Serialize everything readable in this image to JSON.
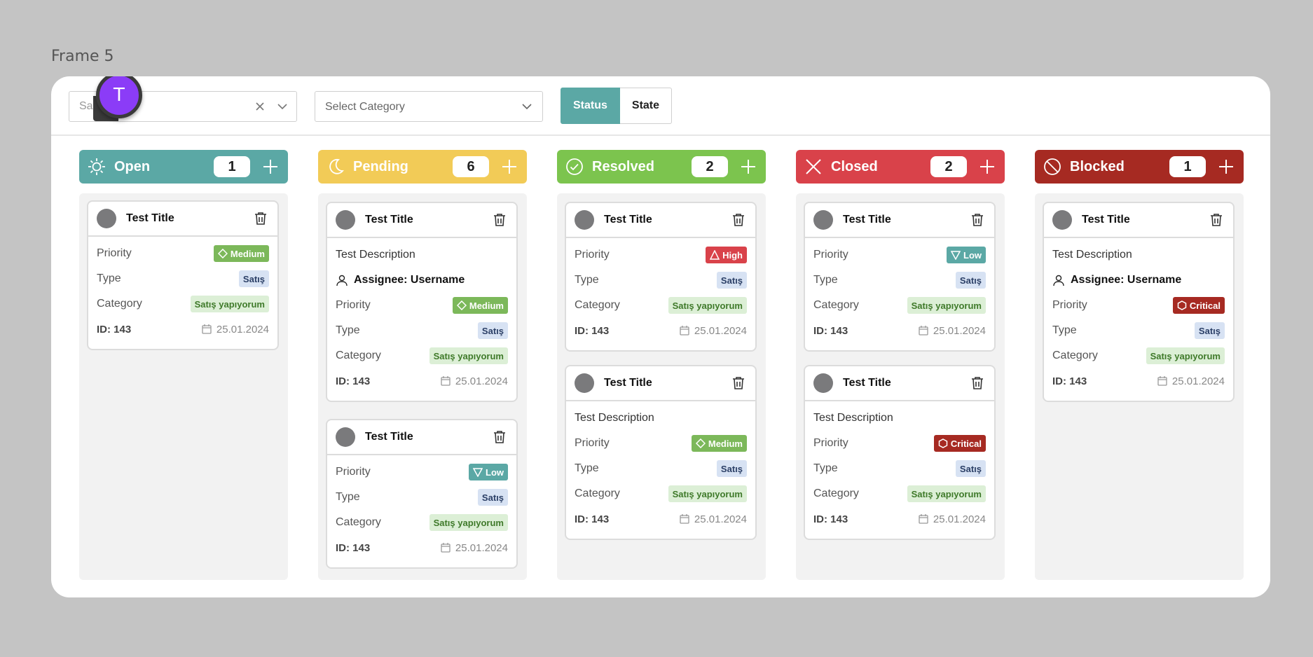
{
  "frame_label": "Frame 5",
  "toolbar": {
    "search_placeholder": "Sa",
    "avatar_letter": "T",
    "category_placeholder": "Select Category",
    "segment_status": "Status",
    "segment_state": "State"
  },
  "colors": {
    "open": "#5ba8a5",
    "pending": "#f2cb57",
    "resolved": "#7cc44e",
    "closed": "#d9424a",
    "blocked": "#a62a22"
  },
  "columns": [
    {
      "title": "Open",
      "count": "1",
      "icon": "sun-icon"
    },
    {
      "title": "Pending",
      "count": "6",
      "icon": "moon-icon"
    },
    {
      "title": "Resolved",
      "count": "2",
      "icon": "check-circle-icon"
    },
    {
      "title": "Closed",
      "count": "2",
      "icon": "x-icon"
    },
    {
      "title": "Blocked",
      "count": "1",
      "icon": "blocked-icon"
    }
  ],
  "labels": {
    "priority": "Priority",
    "type": "Type",
    "category": "Category"
  },
  "cards": {
    "open_1": {
      "title": "Test Title",
      "priority": "Medium",
      "type": "Satış",
      "category": "Satış yapıyorum",
      "id": "ID: 143",
      "date": "25.01.2024"
    },
    "pending_1": {
      "title": "Test Title",
      "description": "Test Description",
      "assignee": "Assignee: Username",
      "priority": "Medium",
      "type": "Satış",
      "category": "Satış yapıyorum",
      "id": "ID: 143",
      "date": "25.01.2024"
    },
    "pending_2": {
      "title": "Test Title",
      "priority": "Low",
      "type": "Satış",
      "category": "Satış yapıyorum",
      "id": "ID: 143",
      "date": "25.01.2024"
    },
    "resolved_1": {
      "title": "Test Title",
      "priority": "High",
      "type": "Satış",
      "category": "Satış yapıyorum",
      "id": "ID: 143",
      "date": "25.01.2024"
    },
    "resolved_2": {
      "title": "Test Title",
      "description": "Test Description",
      "priority": "Medium",
      "type": "Satış",
      "category": "Satış yapıyorum",
      "id": "ID: 143",
      "date": "25.01.2024"
    },
    "closed_1": {
      "title": "Test Title",
      "priority": "Low",
      "type": "Satış",
      "category": "Satış yapıyorum",
      "id": "ID: 143",
      "date": "25.01.2024"
    },
    "closed_2": {
      "title": "Test Title",
      "description": "Test Description",
      "priority": "Critical",
      "type": "Satış",
      "category": "Satış yapıyorum",
      "id": "ID: 143",
      "date": "25.01.2024"
    },
    "blocked_1": {
      "title": "Test Title",
      "description": "Test Description",
      "assignee": "Assignee: Username",
      "priority": "Critical",
      "type": "Satış",
      "category": "Satış yapıyorum",
      "id": "ID: 143",
      "date": "25.01.2024"
    }
  }
}
